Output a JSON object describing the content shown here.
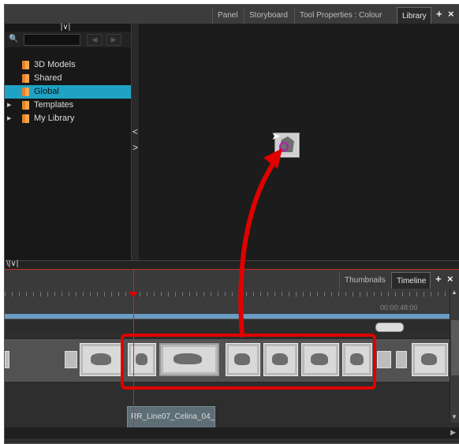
{
  "top_tabs": [
    {
      "label": "Panel"
    },
    {
      "label": "Storyboard"
    },
    {
      "label": "Tool Properties : Colour"
    },
    {
      "label": "Library",
      "active": true
    }
  ],
  "top_tab_add": "+",
  "top_tab_close": "×",
  "library_tree": [
    {
      "label": "3D Models",
      "expandable": false,
      "selected": false
    },
    {
      "label": "Shared",
      "expandable": false,
      "selected": false
    },
    {
      "label": "Global",
      "expandable": false,
      "selected": true
    },
    {
      "label": "Templates",
      "expandable": true,
      "selected": false
    },
    {
      "label": "My Library",
      "expandable": true,
      "selected": false
    }
  ],
  "bottom_tabs": [
    {
      "label": "Thumbnails"
    },
    {
      "label": "Timeline",
      "active": true
    }
  ],
  "bottom_tab_add": "+",
  "bottom_tab_close": "×",
  "timeline": {
    "timecode": "00:00:48:00",
    "clip_label": "RR_Line07_Celina_04_"
  },
  "colors": {
    "selection": "#1fa3c5",
    "annotation_red": "#e10000",
    "timeline_blue": "#6a9cc4"
  },
  "icons": [
    "search-icon",
    "chevron-left-icon",
    "chevron-right-icon",
    "folder-icon",
    "expand-arrow-icon",
    "cursor-icon",
    "plus-icon",
    "close-icon",
    "scroll-up-icon",
    "scroll-down-icon"
  ]
}
